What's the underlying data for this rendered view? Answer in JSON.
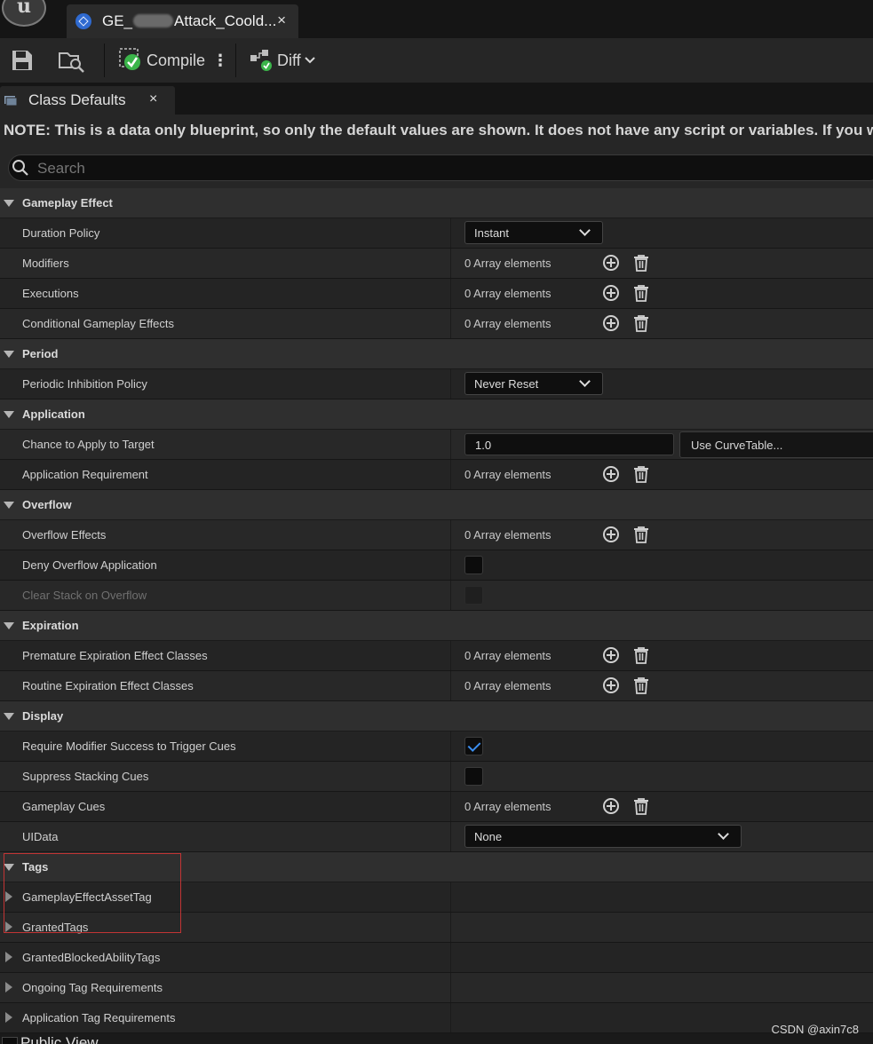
{
  "title_bar": {
    "tab_title_prefix": "GE_",
    "tab_title_suffix": "Attack_Coold...",
    "close_glyph": "×"
  },
  "toolbar": {
    "compile_label": "Compile",
    "diff_label": "Diff",
    "more_glyph": "⋮"
  },
  "panel": {
    "tab_label": "Class Defaults",
    "close_glyph": "×",
    "note": "NOTE: This is a data only blueprint, so only the default values are shown.  It does not have any script or variables.  If you want t",
    "search_placeholder": "Search"
  },
  "rows": [
    {
      "type": "category",
      "label": "Gameplay Effect"
    },
    {
      "type": "combo",
      "label": "Duration Policy",
      "value": "Instant",
      "width": "narrow"
    },
    {
      "type": "array",
      "label": "Modifiers",
      "value": "0 Array elements"
    },
    {
      "type": "array",
      "label": "Executions",
      "value": "0 Array elements"
    },
    {
      "type": "array",
      "label": "Conditional Gameplay Effects",
      "value": "0 Array elements"
    },
    {
      "type": "category",
      "label": "Period"
    },
    {
      "type": "combo",
      "label": "Periodic Inhibition Policy",
      "value": "Never Reset",
      "width": "narrow"
    },
    {
      "type": "category",
      "label": "Application"
    },
    {
      "type": "number",
      "label": "Chance to Apply to Target",
      "value": "1.0",
      "extra": "Use CurveTable..."
    },
    {
      "type": "array",
      "label": "Application Requirement",
      "value": "0 Array elements"
    },
    {
      "type": "category",
      "label": "Overflow"
    },
    {
      "type": "array",
      "label": "Overflow Effects",
      "value": "0 Array elements"
    },
    {
      "type": "checkbox",
      "label": "Deny Overflow Application",
      "checked": false
    },
    {
      "type": "checkbox",
      "label": "Clear Stack on Overflow",
      "checked": false,
      "disabled": true
    },
    {
      "type": "category",
      "label": "Expiration"
    },
    {
      "type": "array",
      "label": "Premature Expiration Effect Classes",
      "value": "0 Array elements"
    },
    {
      "type": "array",
      "label": "Routine Expiration Effect Classes",
      "value": "0 Array elements"
    },
    {
      "type": "category",
      "label": "Display"
    },
    {
      "type": "checkbox",
      "label": "Require Modifier Success to Trigger Cues",
      "checked": true
    },
    {
      "type": "checkbox",
      "label": "Suppress Stacking Cues",
      "checked": false
    },
    {
      "type": "array",
      "label": "Gameplay Cues",
      "value": "0 Array elements"
    },
    {
      "type": "combo",
      "label": "UIData",
      "value": "None",
      "width": "wide"
    },
    {
      "type": "category",
      "label": "Tags"
    },
    {
      "type": "collapsed",
      "label": "GameplayEffectAssetTag"
    },
    {
      "type": "collapsed",
      "label": "GrantedTags"
    },
    {
      "type": "collapsed",
      "label": "GrantedBlockedAbilityTags"
    },
    {
      "type": "collapsed",
      "label": "Ongoing Tag Requirements"
    },
    {
      "type": "collapsed",
      "label": "Application Tag Requirements"
    }
  ],
  "footer": {
    "partial_label": "Public View",
    "watermark": "CSDN @axin7c8"
  },
  "colors": {
    "accent_blue": "#3b8ef0",
    "highlight_red": "#c23434",
    "compile_ok_green": "#3bb54a"
  }
}
